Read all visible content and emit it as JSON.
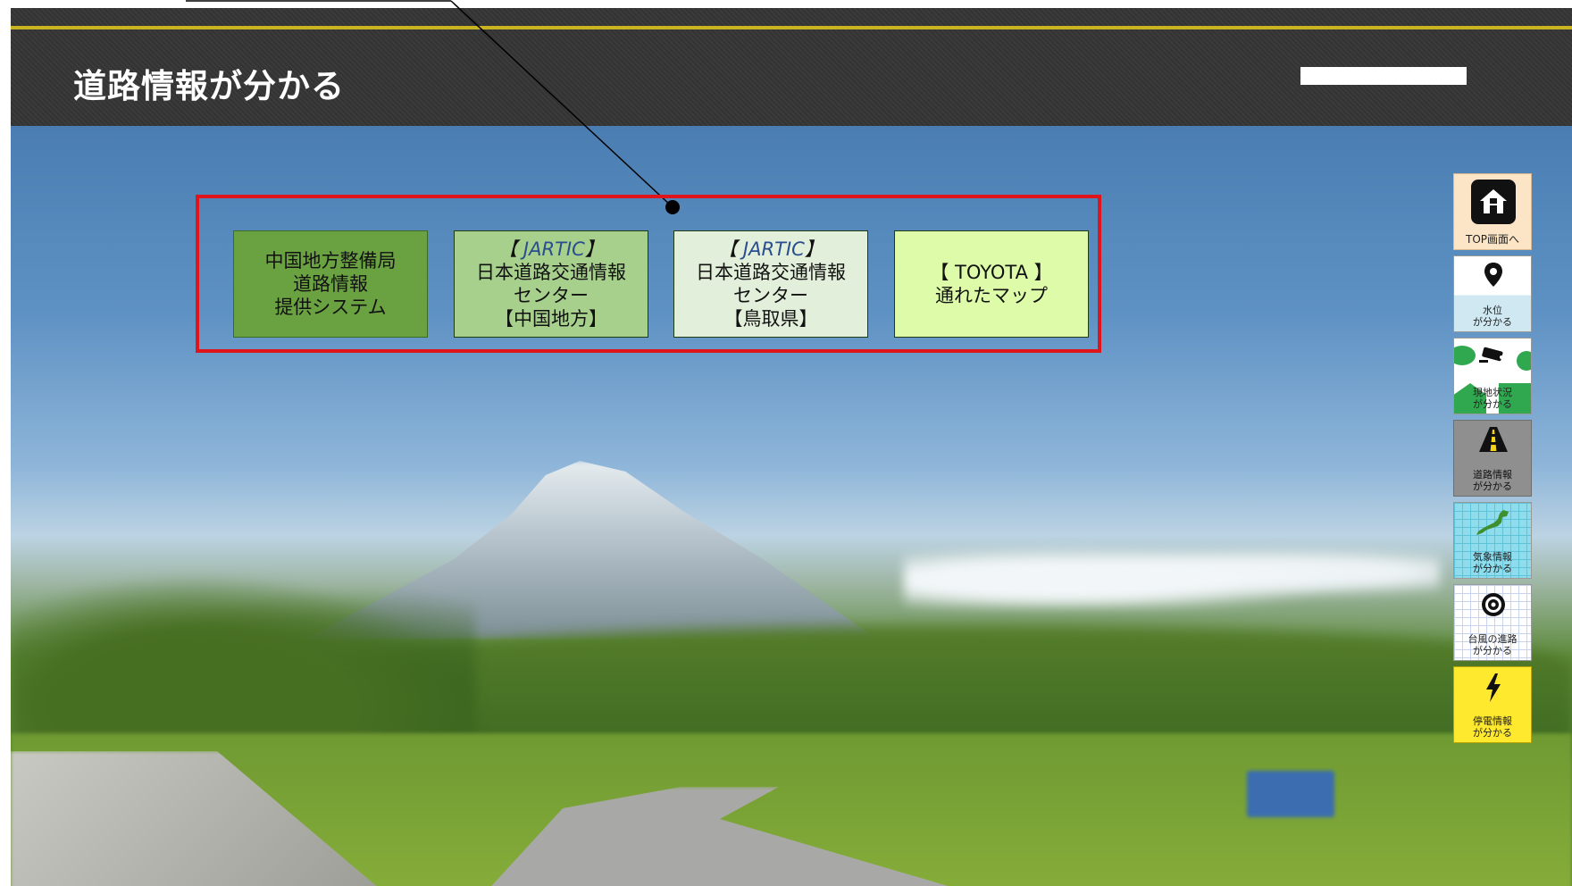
{
  "header": {
    "title": "道路情報が分かる"
  },
  "links": [
    {
      "lines": [
        "中国地方整備局",
        "道路情報",
        "提供システム"
      ]
    },
    {
      "prefix_open": "【 ",
      "brand": "JARTIC",
      "prefix_close": "】",
      "lines": [
        "日本道路交通情報",
        "センター",
        "【中国地方】"
      ]
    },
    {
      "prefix_open": "【 ",
      "brand": "JARTIC",
      "prefix_close": "】",
      "lines": [
        "日本道路交通情報",
        "センター",
        "【鳥取県】"
      ]
    },
    {
      "lines": [
        "【 TOYOTA 】",
        "通れたマップ"
      ]
    }
  ],
  "side_nav": {
    "top": {
      "label": "TOP画面へ",
      "icon": "home-icon"
    },
    "water": {
      "label_1": "水位",
      "label_2": "が分かる",
      "icon": "map-pin-icon"
    },
    "camera": {
      "label_1": "現地状況",
      "label_2": "が分かる",
      "icon": "camera-icon"
    },
    "road": {
      "label_1": "道路情報",
      "label_2": "が分かる",
      "icon": "road-icon"
    },
    "weather": {
      "label_1": "気象情報",
      "label_2": "が分かる",
      "icon": "japan-map-icon"
    },
    "typhoon": {
      "label_1": "台風の進路",
      "label_2": "が分かる",
      "icon": "typhoon-icon"
    },
    "outage": {
      "label_1": "停電情報",
      "label_2": "が分かる",
      "icon": "lightning-icon"
    }
  },
  "colors": {
    "header_bg": "#383838",
    "header_stripe": "#c8b320",
    "highlight_frame": "#e0151b",
    "link_1_bg": "#6aa242",
    "link_2_bg": "#a7d08c",
    "link_3_bg": "#e2efda",
    "link_4_bg": "#ddfba8"
  }
}
